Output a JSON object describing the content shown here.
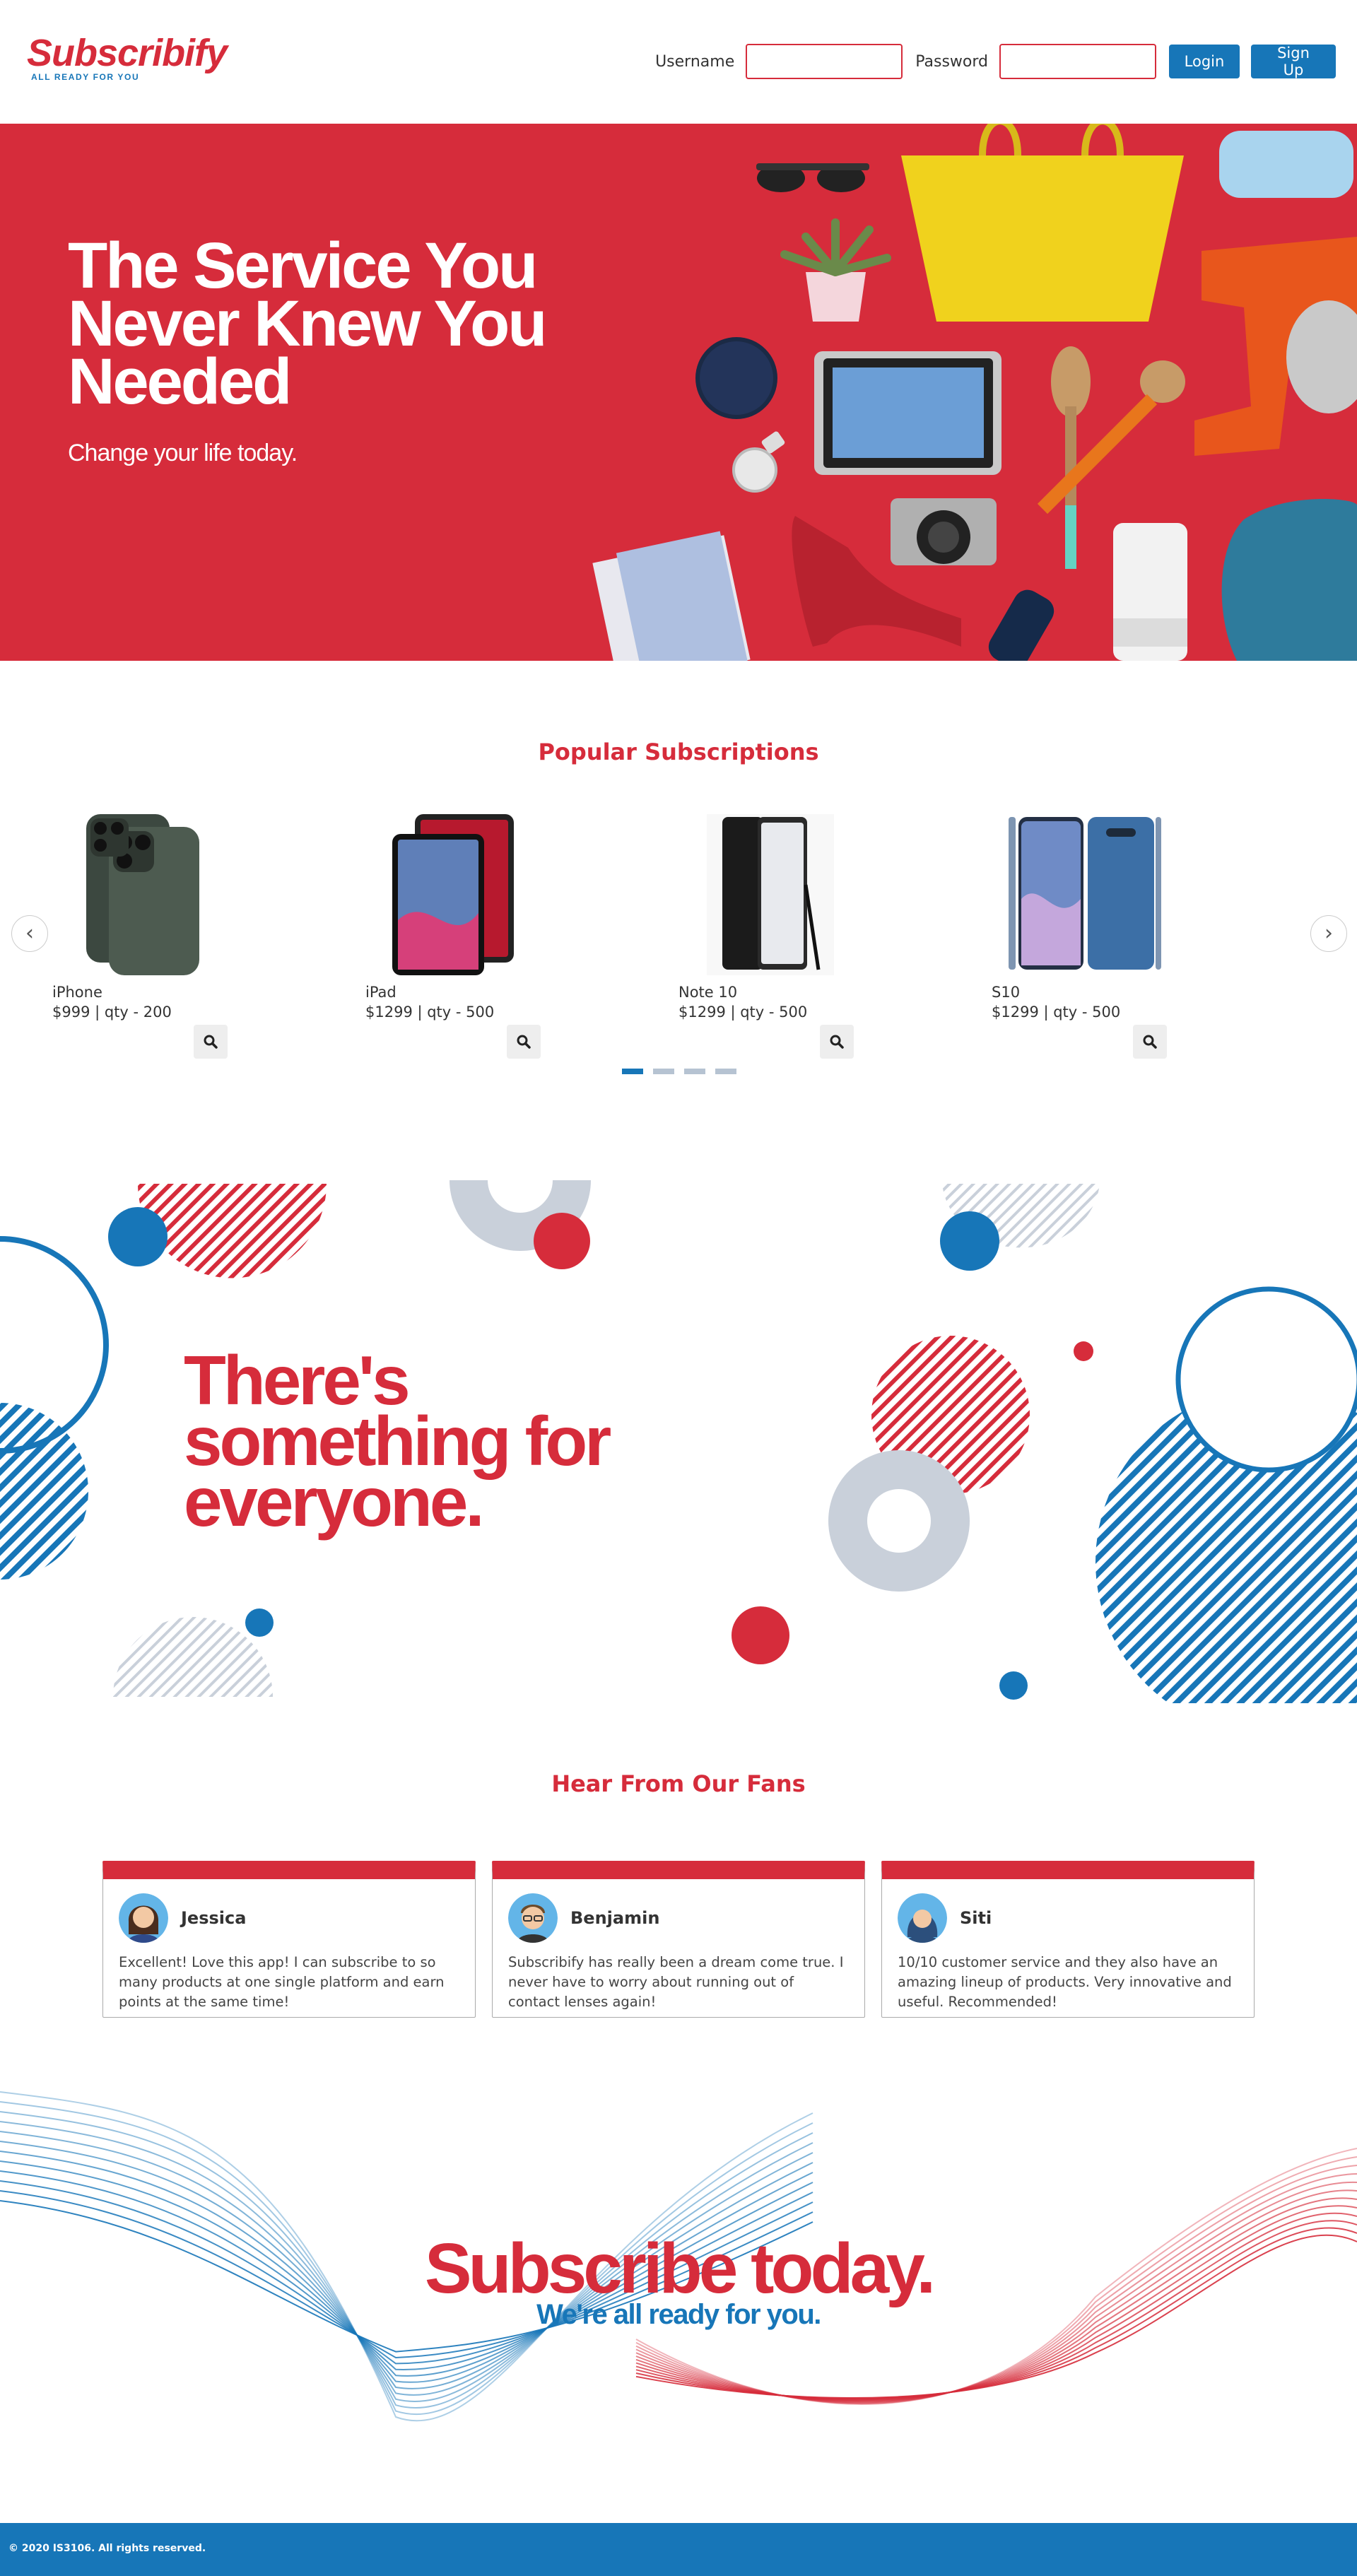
{
  "header": {
    "logo_text": "Subscribify",
    "logo_tagline": "ALL READY FOR YOU",
    "username_label": "Username",
    "password_label": "Password",
    "login_label": "Login",
    "signup_label": "Sign Up"
  },
  "hero": {
    "title": "The Service You Never Knew You Needed",
    "subtitle": "Change your life today."
  },
  "popular": {
    "title": "Popular Subscriptions",
    "products": [
      {
        "name": "iPhone",
        "meta": "$999 | qty - 200"
      },
      {
        "name": "iPad",
        "meta": "$1299 | qty - 500"
      },
      {
        "name": "Note 10",
        "meta": "$1299 | qty - 500"
      },
      {
        "name": "S10",
        "meta": "$1299 | qty - 500"
      }
    ],
    "active_page": 1,
    "page_count": 4
  },
  "everyone": {
    "title": "There's something for everyone."
  },
  "fans": {
    "title": "Hear From Our Fans",
    "reviews": [
      {
        "name": "Jessica",
        "text": "Excellent! Love this app! I can subscribe to so many products at one single platform and earn points at the same time!"
      },
      {
        "name": "Benjamin",
        "text": "Subscribify has really been a dream come true. I never have to worry about running out of contact lenses again!"
      },
      {
        "name": "Siti",
        "text": "10/10 customer service and they also have an amazing lineup of products. Very innovative and useful. Recommended!"
      }
    ]
  },
  "subscribe": {
    "title": "Subscribe today.",
    "subtitle": "We're all ready for you."
  },
  "footer": {
    "copyright": "© 2020 IS3106. All rights reserved."
  },
  "colors": {
    "brand_red": "#d62c3b",
    "brand_blue": "#1776b8",
    "muted_grey": "#c9d0da"
  }
}
